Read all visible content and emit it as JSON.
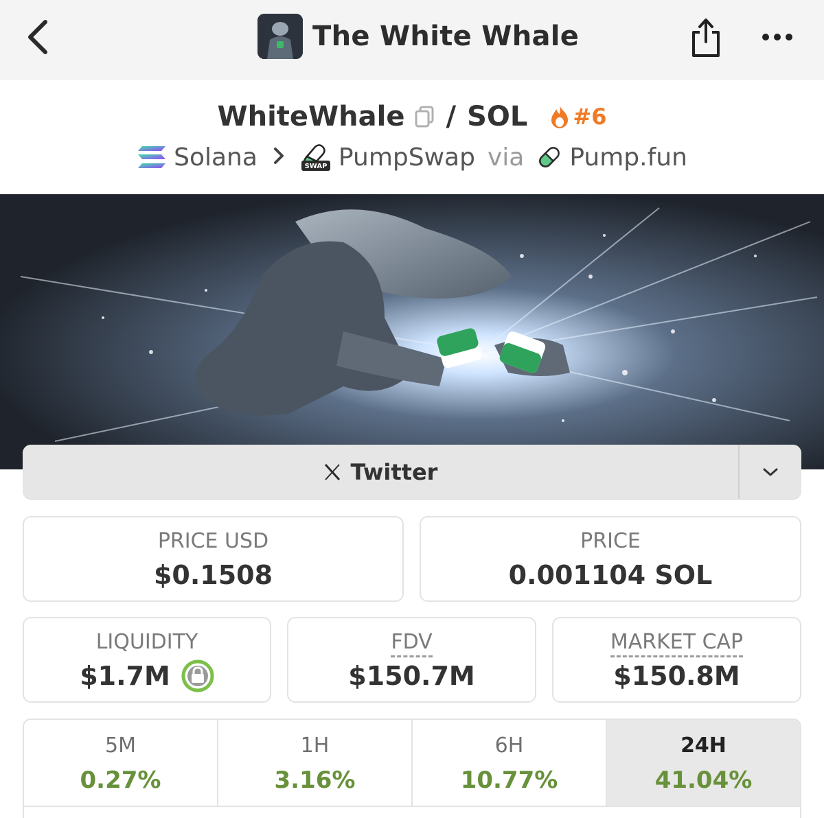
{
  "header": {
    "title": "The White Whale",
    "back_icon": "chevron-left-icon",
    "share_icon": "share-icon",
    "more_icon": "more-dots-icon"
  },
  "pair": {
    "base": "WhiteWhale",
    "separator": "/",
    "quote": "SOL",
    "rank": "#6",
    "rank_color": "#f07a25"
  },
  "route": {
    "chain": "Solana",
    "dex": "PumpSwap",
    "via_label": "via",
    "launchpad": "Pump.fun",
    "dex_badge": "SWAP"
  },
  "social": {
    "twitter_label": "Twitter"
  },
  "stats": {
    "price_usd_label": "PRICE USD",
    "price_usd_value": "$0.1508",
    "price_label": "PRICE",
    "price_value": "0.001104 SOL",
    "liquidity_label": "LIQUIDITY",
    "liquidity_value": "$1.7M",
    "fdv_label": "FDV",
    "fdv_value": "$150.7M",
    "mcap_label": "MARKET CAP",
    "mcap_value": "$150.8M"
  },
  "changes": [
    {
      "label": "5M",
      "value": "0.27%"
    },
    {
      "label": "1H",
      "value": "3.16%"
    },
    {
      "label": "6H",
      "value": "10.77%"
    },
    {
      "label": "24H",
      "value": "41.04%",
      "active": true
    }
  ],
  "colors": {
    "positive": "#67913a",
    "lock": "#7cbf4a",
    "accent_orange": "#f07a25"
  }
}
